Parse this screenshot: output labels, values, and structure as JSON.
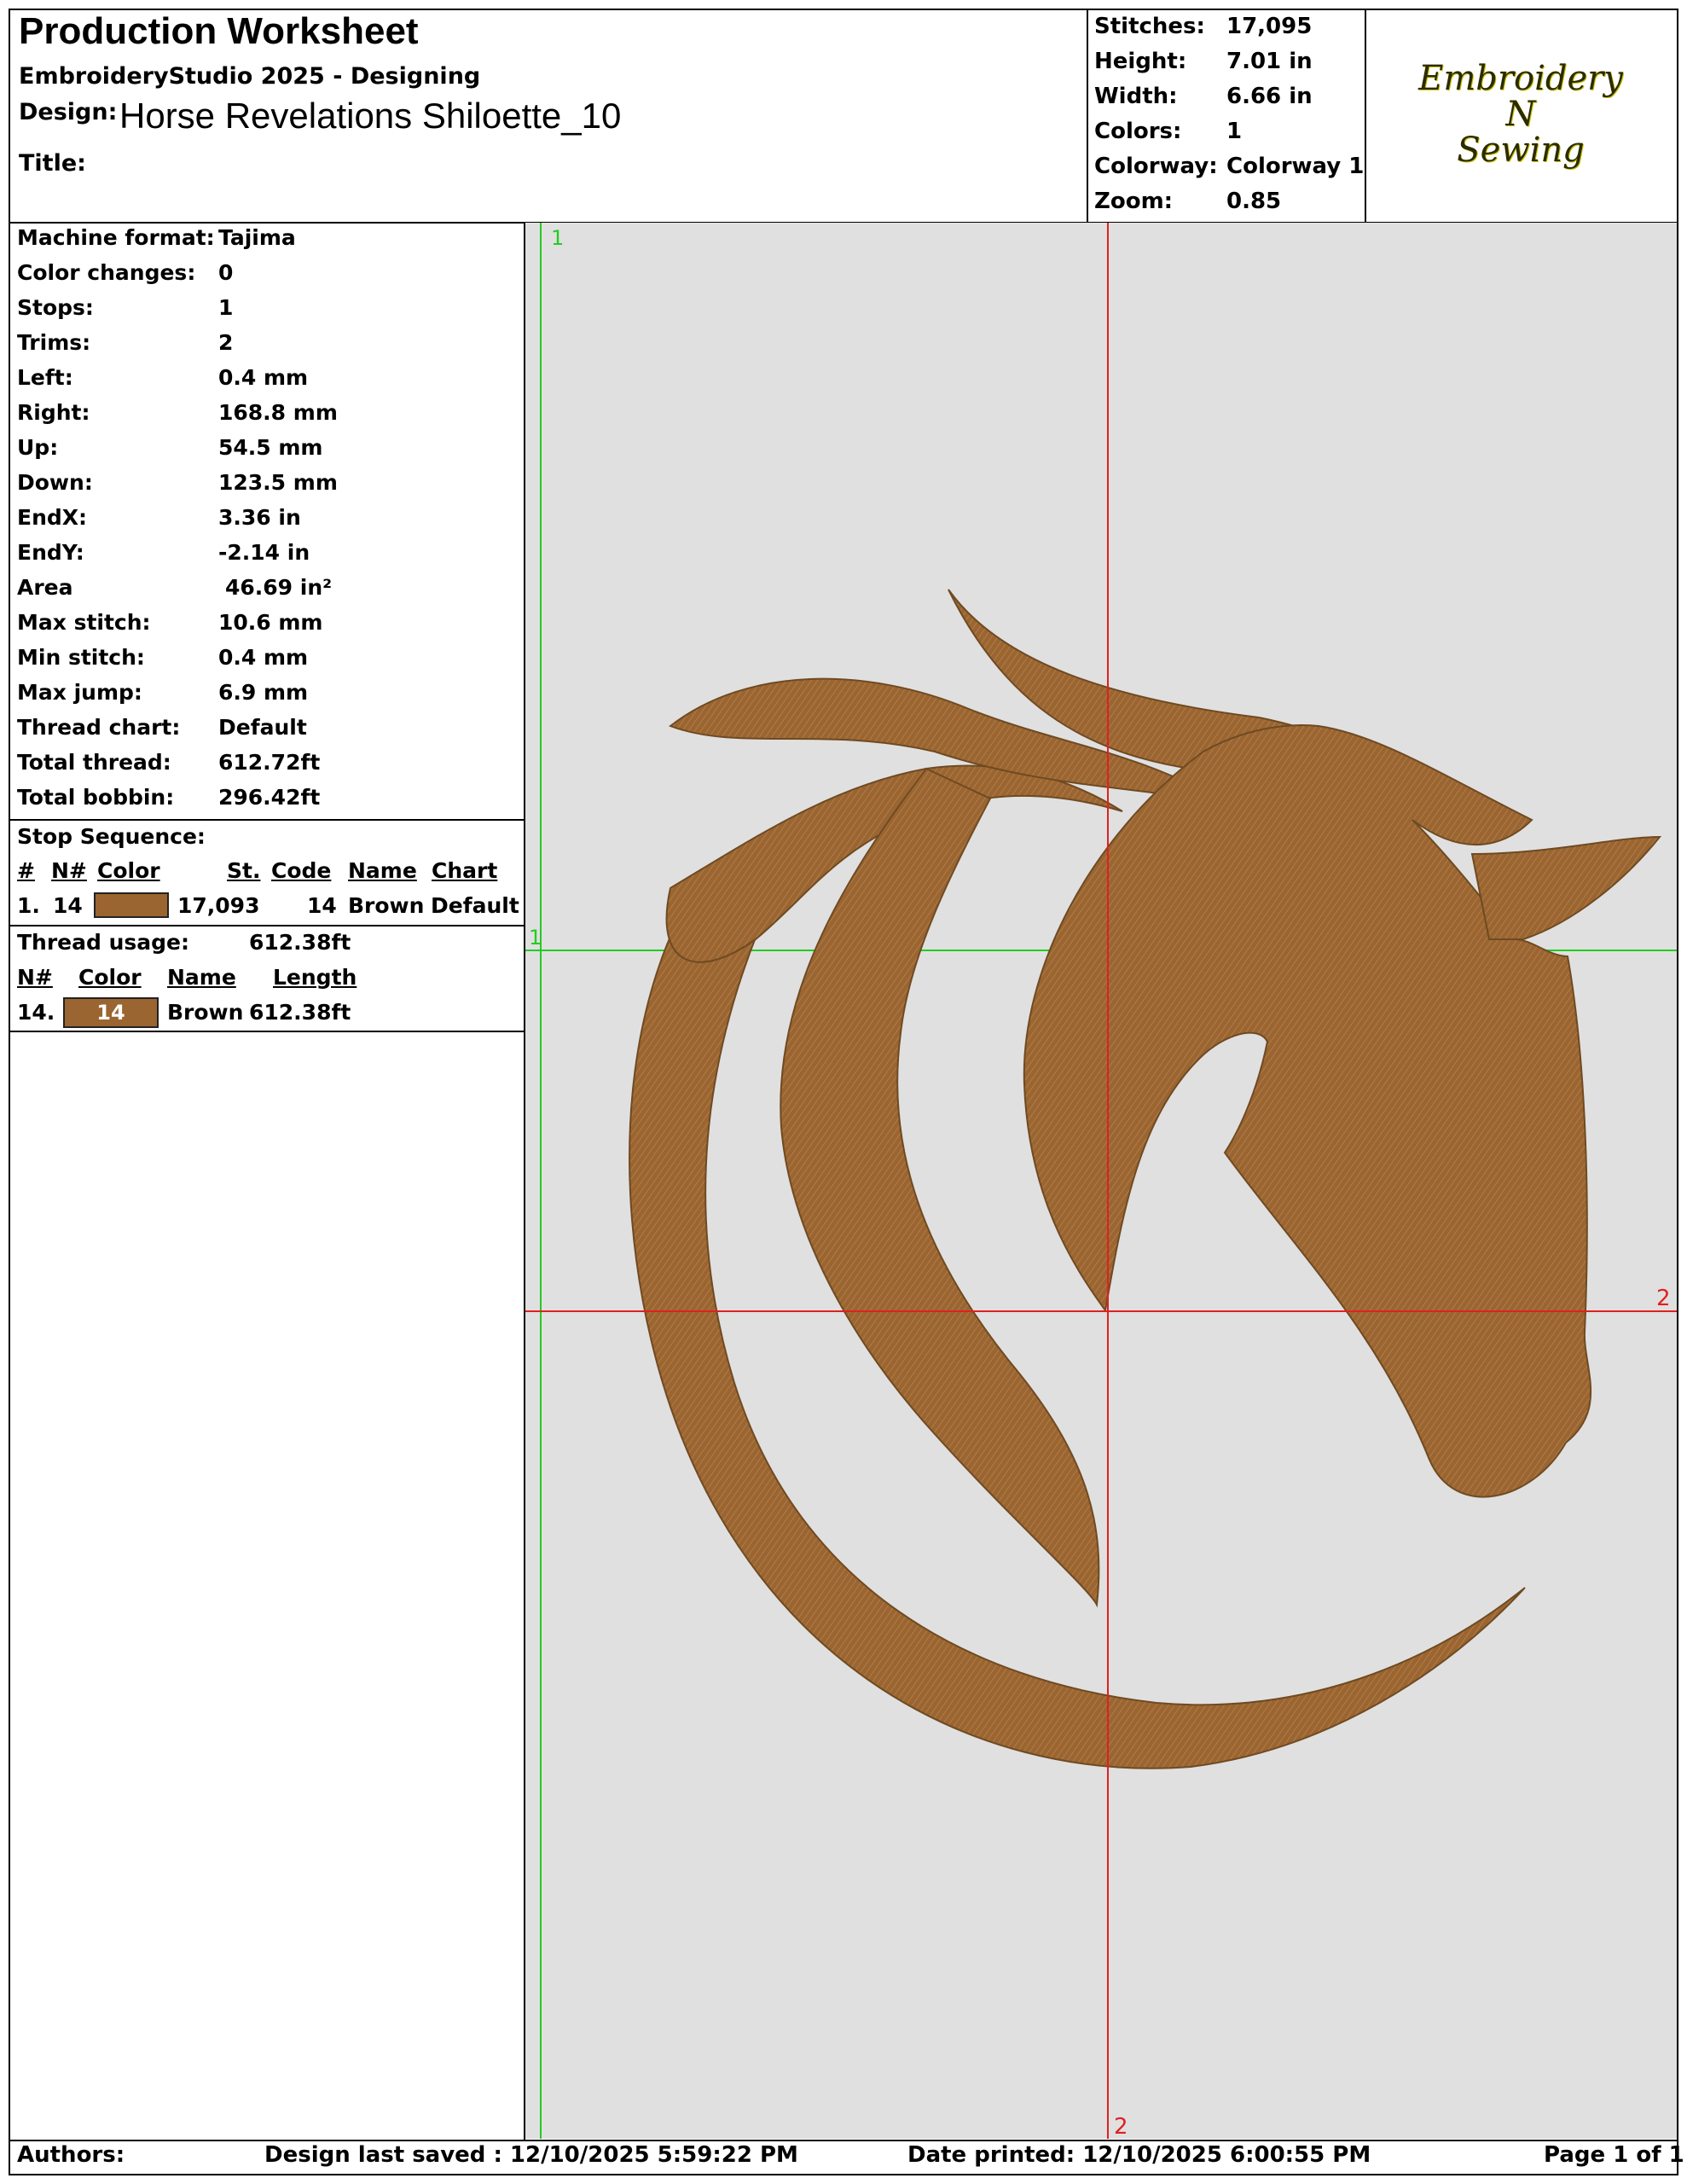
{
  "header": {
    "title": "Production Worksheet",
    "software": "EmbroideryStudio 2025 - Designing",
    "design_label": "Design:",
    "design_name": "Horse Revelations Shiloette_10",
    "title_label": "Title:"
  },
  "stats": [
    {
      "label": "Stitches:",
      "value": "17,095"
    },
    {
      "label": "Height:",
      "value": "7.01 in"
    },
    {
      "label": "Width:",
      "value": "6.66 in"
    },
    {
      "label": "Colors:",
      "value": "1"
    },
    {
      "label": "Colorway:",
      "value": "Colorway 1"
    },
    {
      "label": "Zoom:",
      "value": "0.85"
    }
  ],
  "logo": {
    "line1": "Embroidery",
    "line2": "N",
    "line3": "Sewing"
  },
  "properties": [
    {
      "label": "Machine format:",
      "value": "Tajima"
    },
    {
      "label": "Color changes:",
      "value": "0"
    },
    {
      "label": "Stops:",
      "value": "1"
    },
    {
      "label": "Trims:",
      "value": "2"
    },
    {
      "label": "Left:",
      "value": "0.4 mm"
    },
    {
      "label": "Right:",
      "value": "168.8 mm"
    },
    {
      "label": "Up:",
      "value": "54.5 mm"
    },
    {
      "label": "Down:",
      "value": "123.5 mm"
    },
    {
      "label": "EndX:",
      "value": "3.36 in"
    },
    {
      "label": "EndY:",
      "value": "-2.14 in"
    },
    {
      "label": "Area",
      "value": "46.69 in²"
    },
    {
      "label": "Max stitch:",
      "value": "10.6 mm"
    },
    {
      "label": "Min stitch:",
      "value": "0.4 mm"
    },
    {
      "label": "Max jump:",
      "value": "6.9 mm"
    },
    {
      "label": "Thread chart:",
      "value": "Default"
    },
    {
      "label": "Total thread:",
      "value": "612.72ft"
    },
    {
      "label": "Total bobbin:",
      "value": "296.42ft"
    }
  ],
  "stop_sequence": {
    "title": "Stop Sequence:",
    "headers": {
      "num": "#",
      "needle": "N#",
      "color": "Color",
      "stitches": "St.",
      "code": "Code",
      "name": "Name",
      "chart": "Chart"
    },
    "rows": [
      {
        "num": "1.",
        "needle": "14",
        "stitches": "17,093",
        "code": "14",
        "name": "Brown",
        "chart": "Default"
      }
    ]
  },
  "thread_usage": {
    "label": "Thread usage:",
    "value": "612.38ft",
    "headers": {
      "needle": "N#",
      "color": "Color",
      "name": "Name",
      "length": "Length"
    },
    "rows": [
      {
        "needle": "14.",
        "swatch_label": "14",
        "name": "Brown",
        "length": "612.38ft"
      }
    ]
  },
  "canvas": {
    "markers": {
      "green_top": "1",
      "green_left": "1",
      "red_right": "2",
      "red_bottom": "2"
    },
    "thread_color": "#9a6530",
    "background": "#e0e0e0"
  },
  "footer": {
    "authors_label": "Authors:",
    "saved": "Design last saved : 12/10/2025 5:59:22 PM",
    "printed": "Date printed: 12/10/2025 6:00:55 PM",
    "page": "Page 1 of 1"
  }
}
